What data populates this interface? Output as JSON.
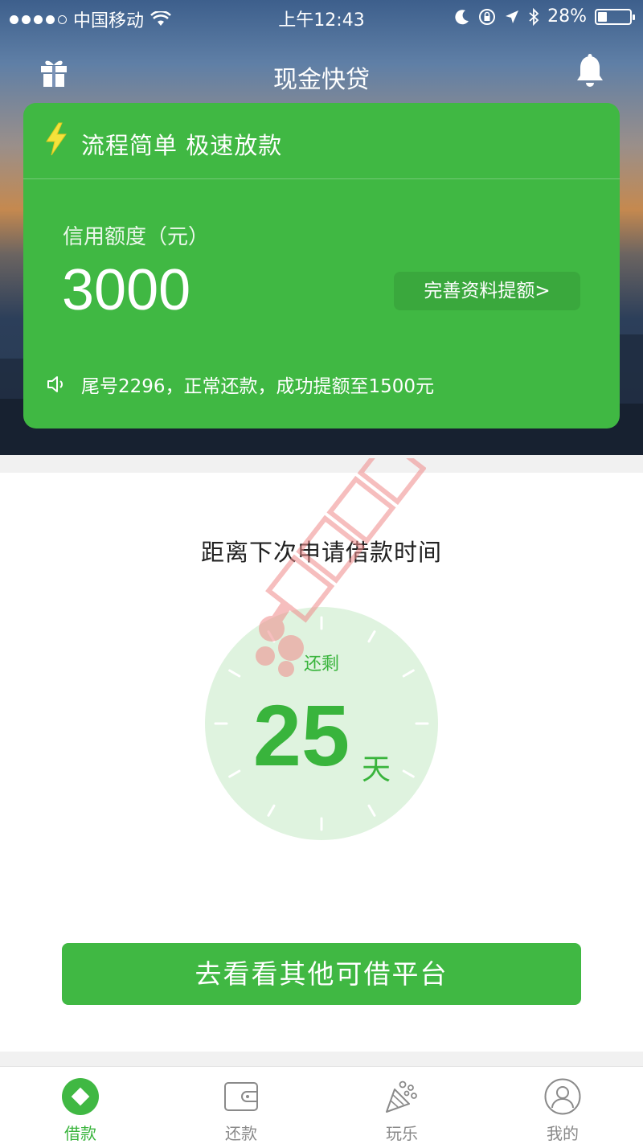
{
  "status_bar": {
    "carrier": "中国移动",
    "time": "上午12:43",
    "battery_percent": "28%",
    "battery_level": 0.28
  },
  "header": {
    "title": "现金快贷",
    "left_icon": "gift-icon",
    "right_icon": "bell-icon"
  },
  "card": {
    "slogan": "流程简单 极速放款",
    "credit_label": "信用额度（元）",
    "credit_amount": "3000",
    "raise_button": "完善资料提额>",
    "notice": "尾号2296，正常还款，成功提额至1500元"
  },
  "countdown": {
    "title": "距离下次申请借款时间",
    "remaining_label": "还剩",
    "days": "25",
    "unit": "天"
  },
  "watermark": {
    "text": "卡农社区"
  },
  "cta": {
    "label": "去看看其他可借平台"
  },
  "tabbar": {
    "tabs": [
      {
        "label": "借款",
        "icon": "diamond-circle-icon",
        "active": true
      },
      {
        "label": "还款",
        "icon": "wallet-icon",
        "active": false
      },
      {
        "label": "玩乐",
        "icon": "party-cone-icon",
        "active": false
      },
      {
        "label": "我的",
        "icon": "user-icon",
        "active": false
      }
    ]
  },
  "colors": {
    "primary": "#40b843",
    "accent_text": "#39b43c",
    "dial_fill": "#dff3df",
    "inactive": "#8a8a8a"
  }
}
